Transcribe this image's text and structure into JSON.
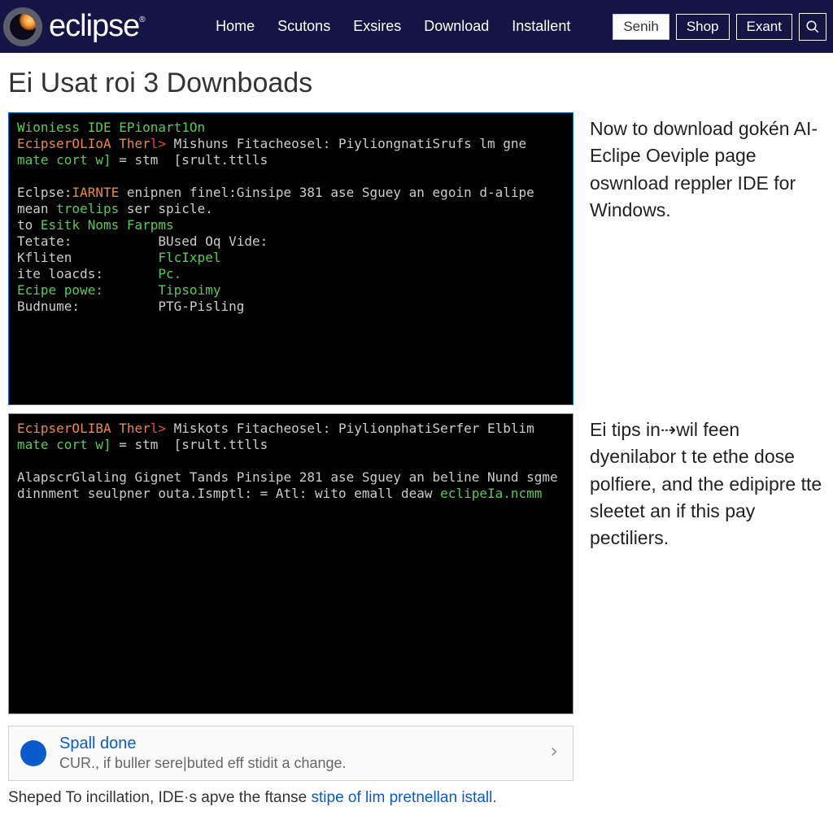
{
  "header": {
    "brand": "eclipse",
    "nav": [
      "Home",
      "Scutons",
      "Exsires",
      "Download",
      "Installent"
    ],
    "btn_primary": "Senih",
    "btn_shop": "Shop",
    "btn_exant": "Exant"
  },
  "page": {
    "title": "Ei Usat roi 3 Downboads"
  },
  "terminal1": {
    "l1a": "Wioniess IDE EPionart1On",
    "l2a": "EcipserOLIoA Ther",
    "l2b": "l>",
    "l2c": " Mishuns Fitacheosel: PiyliongnatiSrufs lm gne",
    "l3a": "mate cort w]",
    "l3b": " = stm  [srult.ttlls",
    "l4a": "Eclpse:",
    "l4b": "IARNTE",
    "l4c": " enipnen finel:Ginsipe 381 ase Sguey an egoin d-alipe",
    "l5a": "mean ",
    "l5b": "troelips",
    "l5c": " ser spicle.",
    "l6a": "to ",
    "l6b": "Esitk Noms Farpms",
    "l7a": "Tetate:           BUsed Oq Vide:",
    "l8a": "Kfliten           ",
    "l8b": "FlcIxpel",
    "l9a": "ite loacds:       ",
    "l9b": "Pc.",
    "l10a": "Ecipe powe:",
    "l10b": "       Tipsoimy",
    "l11a": "Budnume:          PTG-Pisling"
  },
  "aside1": "Now to download gokén AI-Eclipe Oeviple page oswnload reppler IDE for Windows.",
  "terminal2": {
    "l1a": "EcipserOLIBA Ther",
    "l1b": "l>",
    "l1c": " Miskots Fitacheosel: PiylionphatiSerfer Elblim",
    "l2a": "mate cort w]",
    "l2b": " = stm  [srult.ttlls",
    "l3a": "AlapscrGlaling Gignet Tands Pinsipe 281 ase Sguey an beline Nund sgme",
    "l4a": "dinnment seulpner outa.Ismptl: = Atl: wito emall deaw ",
    "l4b": "eclipeIa.ncmm"
  },
  "aside2": "Ei tips in⇢wil feen dyenilabor t te ethe dose polfiere, and the edipipre tte sleetet an if this pay pectiliers.",
  "callout": {
    "title": "Spall done",
    "sub": "CUR., if buller sere|buted eff stidit a change."
  },
  "footline_a": "Sheped To incillation, IDE·s apve the ftanse ",
  "footline_b": "stipe of lim pretnellan istall."
}
